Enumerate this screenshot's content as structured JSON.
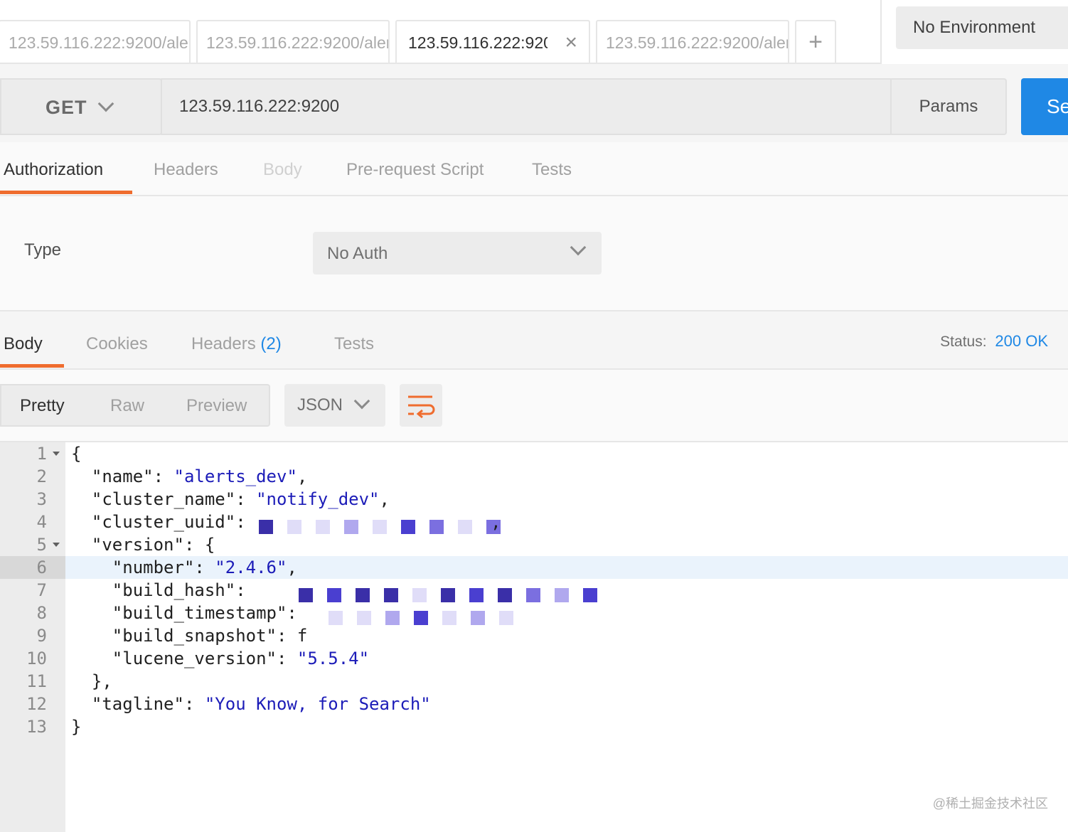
{
  "tabs": [
    {
      "label": "123.59.116.222:9200/aler",
      "active": false
    },
    {
      "label": "123.59.116.222:9200/aler",
      "active": false
    },
    {
      "label": "123.59.116.222:920",
      "active": true,
      "close": "×"
    },
    {
      "label": "123.59.116.222:9200/aler",
      "active": false
    }
  ],
  "add_tab_label": "+",
  "environment": "No Environment",
  "request": {
    "method": "GET",
    "url": "123.59.116.222:9200",
    "params_label": "Params",
    "send_label": "Se"
  },
  "request_tabs": {
    "authorization": "Authorization",
    "headers": "Headers",
    "body": "Body",
    "prerequest": "Pre-request Script",
    "tests": "Tests"
  },
  "auth": {
    "type_label": "Type",
    "type_value": "No Auth"
  },
  "response_tabs": {
    "body": "Body",
    "cookies": "Cookies",
    "headers": "Headers",
    "headers_count": "(2)",
    "tests": "Tests"
  },
  "status": {
    "label": "Status:",
    "value": "200 OK"
  },
  "view": {
    "pretty": "Pretty",
    "raw": "Raw",
    "preview": "Preview",
    "format": "JSON"
  },
  "code": {
    "line_numbers": [
      "1",
      "2",
      "3",
      "4",
      "5",
      "6",
      "7",
      "8",
      "9",
      "10",
      "11",
      "12",
      "13"
    ],
    "l1": "{",
    "l2_key": "  \"name\": ",
    "l2_val": "\"alerts_dev\"",
    "l2_end": ",",
    "l3_key": "  \"cluster_name\": ",
    "l3_val": "\"notify_dev\"",
    "l3_end": ",",
    "l4_key": "  \"cluster_uuid\": ",
    "l4_end": ",",
    "l5": "  \"version\": {",
    "l6_key": "    \"number\": ",
    "l6_val": "\"2.4.6\"",
    "l6_end": ",",
    "l7_key": "    \"build_hash\": ",
    "l8_key": "    \"build_timestamp\": ",
    "l9_key": "    \"build_snapshot\": ",
    "l9_val": "f",
    "l10_key": "    \"lucene_version\": ",
    "l10_val": "\"5.5.4\"",
    "l11": "  },",
    "l12_key": "  \"tagline\": ",
    "l12_val": "\"You Know, for Search\"",
    "l13": "}"
  },
  "watermark": "@稀土掘金技术社区",
  "colors": {
    "accent_orange": "#ef6c2e",
    "send_blue": "#1f88e5",
    "string_blue": "#1c1cb8"
  }
}
